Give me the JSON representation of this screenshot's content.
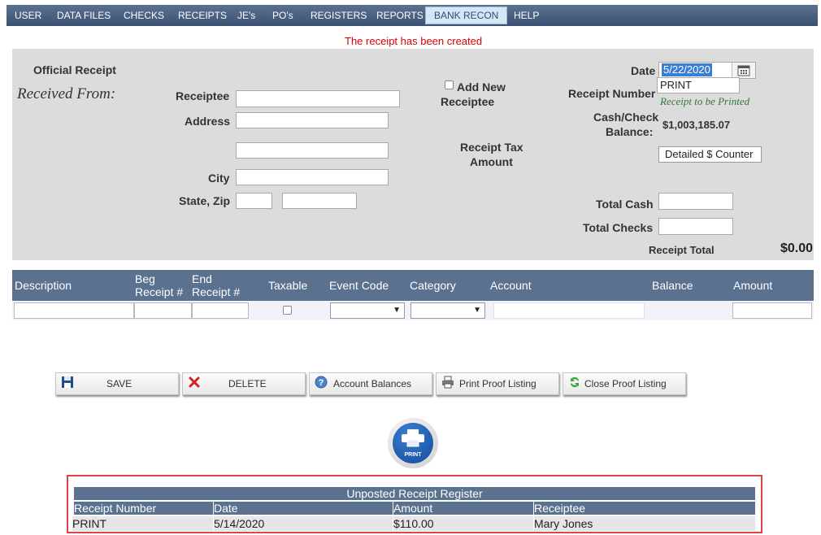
{
  "menu": {
    "items": [
      "USER",
      "DATA FILES",
      "CHECKS",
      "RECEIPTS",
      "JE's",
      "PO's",
      "REGISTERS",
      "REPORTS",
      "BANK RECON",
      "HELP"
    ],
    "active": "BANK RECON"
  },
  "message": "The receipt has been created",
  "form": {
    "official_receipt": "Official Receipt",
    "received_from": "Received From:",
    "receiptee_label": "Receiptee",
    "address_label": "Address",
    "city_label": "City",
    "state_zip_label": "State, Zip",
    "add_new_label": "Add New",
    "receiptee_word": "Receiptee",
    "receipt_tax_label": "Receipt Tax",
    "amount_label": "Amount",
    "date_label": "Date",
    "date_value": "5/22/2020",
    "receipt_number_label": "Receipt Number",
    "receipt_number_value": "PRINT",
    "receipt_to_be_printed": "Receipt to be Printed",
    "cash_check_label": "Cash/Check",
    "balance_label": "Balance:",
    "balance_value": "$1,003,185.07",
    "detailed_counter": "Detailed $ Counter",
    "total_cash_label": "Total Cash",
    "total_checks_label": "Total Checks",
    "receipt_total_label": "Receipt Total",
    "receipt_total_value": "$0.00"
  },
  "grid": {
    "description": "Description",
    "beg_receipt_1": "Beg",
    "beg_receipt_2": "Receipt #",
    "end_receipt_1": "End",
    "end_receipt_2": "Receipt #",
    "taxable": "Taxable",
    "event_code": "Event Code",
    "category": "Category",
    "account": "Account",
    "balance": "Balance",
    "amount": "Amount"
  },
  "actions": {
    "save": "SAVE",
    "delete": "DELETE",
    "account_balances": "Account Balances",
    "print_proof": "Print Proof Listing",
    "close_proof": "Close Proof Listing"
  },
  "print_badge": "PRINT",
  "register": {
    "title": "Unposted Receipt Register",
    "columns": [
      "Receipt Number",
      "Date",
      "Amount",
      "Receiptee"
    ],
    "rows": [
      [
        "PRINT",
        "5/14/2020",
        "$110.00",
        "Mary Jones"
      ]
    ]
  },
  "colors": {
    "header_blue": "#5a7190",
    "message_red": "#dd0000",
    "highlight_red": "#e04444"
  }
}
